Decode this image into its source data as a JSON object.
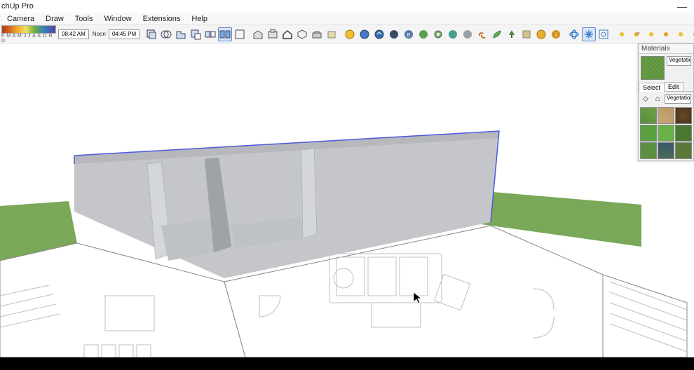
{
  "window": {
    "title": "chUp Pro",
    "minimize": "—"
  },
  "menu": {
    "items": [
      "Camera",
      "Draw",
      "Tools",
      "Window",
      "Extensions",
      "Help"
    ]
  },
  "toolbar": {
    "months": "F M A M J J A S O R D",
    "time_left": "08:42 AM",
    "noon": "Noon",
    "time_right": "04:45 PM"
  },
  "materials": {
    "header": "Materials",
    "current_name": "Vegetation_g",
    "tabs": {
      "select": "Select",
      "edit": "Edit"
    },
    "library": "Vegetation"
  }
}
